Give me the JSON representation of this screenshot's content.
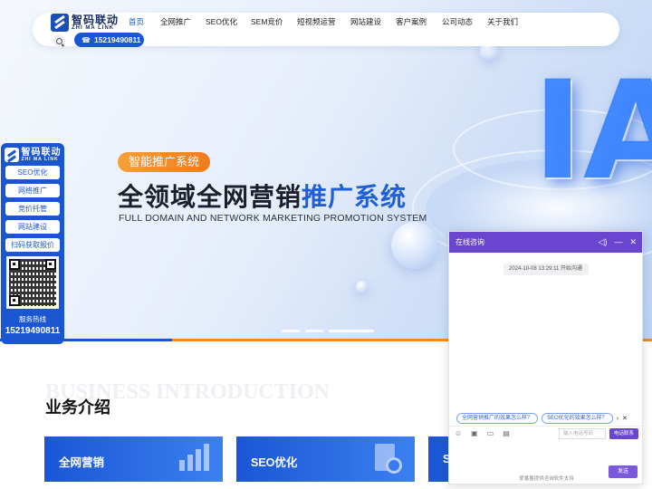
{
  "nav": {
    "logo_cn": "智码联动",
    "logo_en": "ZHI MA LINK",
    "phone": "15219490811",
    "menu": [
      "首页",
      "全网推广",
      "SEO优化",
      "SEM竞价",
      "短视频运营",
      "网站建设",
      "客户案例",
      "公司动态",
      "关于我们"
    ],
    "active_index": 0
  },
  "hero": {
    "tag": "智能推广系统",
    "title_main": "全领域全网营销",
    "title_highlight": "推广系统",
    "subtitle": "FULL DOMAIN AND NETWORK MARKETING PROMOTION SYSTEM",
    "art_text": "IA",
    "slides": 3,
    "active_slide": 2
  },
  "side_panel": {
    "logo_cn": "智码联动",
    "logo_en": "ZHI MA LINK",
    "buttons": [
      "SEO优化",
      "网络推广",
      "竞价托管",
      "网站建设",
      "扫码获取报价"
    ],
    "hotline_label": "服务热线",
    "hotline": "15219490811"
  },
  "business": {
    "bg_word": "BUSINESS INTRODUCTION",
    "title": "业务介绍",
    "cards": [
      "全网营销",
      "SEO优化",
      "S"
    ]
  },
  "chat": {
    "title": "在线咨询",
    "timestamp": "2024-10-08 13:29:11 开始沟通",
    "quick_questions": [
      "全网营销推广的效果怎么样？",
      "SEO优化的效果怎么样？"
    ],
    "input_placeholder": "输入电话号码",
    "leave_label": "电话联系",
    "send_label": "发送",
    "powered": "爱番番提供咨询软件支持"
  },
  "colors": {
    "brand_blue": "#1a57d2",
    "accent_orange": "#f08a24",
    "chat_purple": "#6a45d0"
  }
}
